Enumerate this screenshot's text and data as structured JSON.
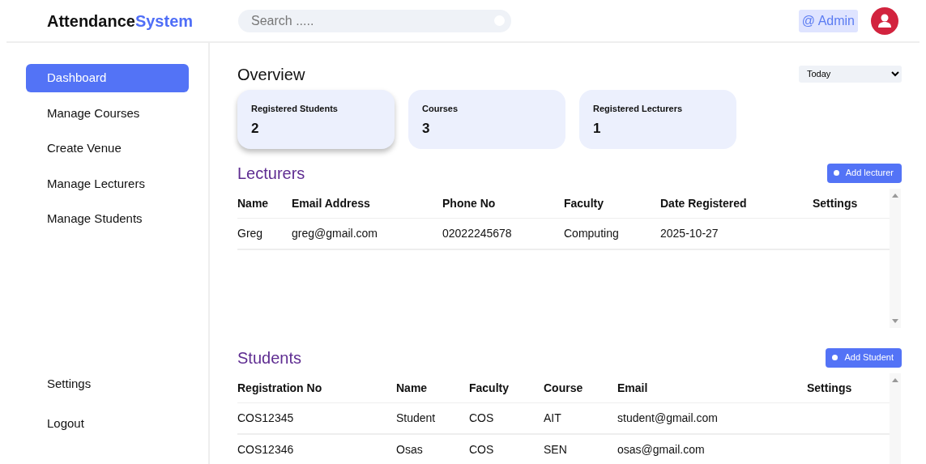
{
  "header": {
    "logo": {
      "part_1": "Attendance",
      "part_2": "System"
    },
    "search": {
      "placeholder": "Search ....."
    },
    "user_label": "@ Admin"
  },
  "sidebar": {
    "items": [
      {
        "label": "Dashboard",
        "selected": true
      },
      {
        "label": "Manage Courses",
        "selected": false
      },
      {
        "label": "Create Venue",
        "selected": false
      },
      {
        "label": "Manage Lecturers",
        "selected": false
      },
      {
        "label": "Manage Students",
        "selected": false
      }
    ],
    "bottom_items": [
      {
        "label": "Settings"
      },
      {
        "label": "Logout"
      }
    ]
  },
  "overview": {
    "title": "Overview",
    "period": "Today",
    "cards": [
      {
        "label": "Registered Students",
        "value": "2",
        "raised": true
      },
      {
        "label": "Courses",
        "value": "3",
        "raised": false
      },
      {
        "label": "Registered Lecturers",
        "value": "1",
        "raised": false
      }
    ]
  },
  "lecturers": {
    "title": "Lecturers",
    "button": "Add lecturer",
    "columns": [
      "Name",
      "Email Address",
      "Phone No",
      "Faculty",
      "Date Registered",
      "Settings"
    ],
    "rows": [
      [
        "Greg",
        "greg@gmail.com",
        "02022245678",
        "Computing",
        "2025-10-27",
        ""
      ]
    ]
  },
  "students": {
    "title": "Students",
    "button": "Add Student",
    "columns": [
      "Registration No",
      "Name",
      "Faculty",
      "Course",
      "Email",
      "Settings"
    ],
    "rows": [
      [
        "COS12345",
        "Student",
        "COS",
        "AIT",
        "student@gmail.com",
        ""
      ],
      [
        "COS12346",
        "Osas",
        "COS",
        "SEN",
        "osas@gmail.com",
        ""
      ]
    ]
  }
}
